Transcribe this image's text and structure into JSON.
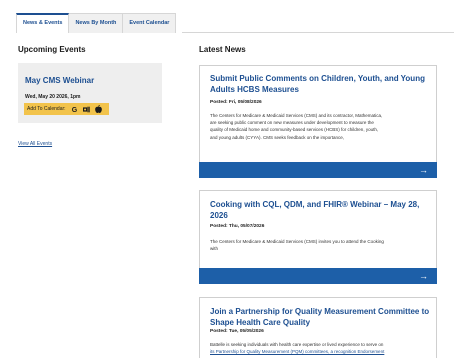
{
  "tabs": [
    "News & Events",
    "News By Month",
    "Event Calendar"
  ],
  "upcoming": {
    "heading": "Upcoming Events",
    "event": {
      "title": "May CMS Webinar",
      "date": "Wed, May 20 2026, 1pm",
      "add_label": "Add To Calendar:",
      "icons": [
        "google-icon",
        "outlook-icon",
        "apple-icon"
      ]
    },
    "view_all": "View All Events"
  },
  "news": {
    "heading": "Latest News",
    "items": [
      {
        "title_lines": [
          "Submit Public Comments on Children, Youth, and Young",
          "Adults HCBS Measures"
        ],
        "posted": "Posted:  Fri, 05/08/2026",
        "body_lines": [
          "The Centers for Medicare & Medicaid Services (CMS) and its contractor, Mathematica,",
          "are seeking public comment on new measures under development to measure the",
          "quality of Medicaid home and community-based services (HCBS) for children, youth,",
          "and young adults (CYYA). CMS seeks feedback on the importance,"
        ]
      },
      {
        "title_lines": [
          "Cooking with CQL, QDM, and FHIR® Webinar – May 28,",
          "2026"
        ],
        "posted": "Posted:  Thu, 05/07/2026",
        "body_lines": [
          "The Centers for Medicare & Medicaid Services (CMS) invites you to attend the Cooking",
          "with"
        ]
      },
      {
        "title_lines": [
          "Join a Partnership for Quality Measurement Committee to",
          "Shape Health Care Quality"
        ],
        "posted": "Posted:  Tue, 05/05/2026",
        "body_lines": [
          "Battelle is seeking individuals with health care expertise or lived experience to serve on",
          "its Partnership for Quality Measurement (PQM) committees, a recognition Endorsement"
        ]
      }
    ]
  },
  "colors": {
    "brand": "#1d4f91",
    "bar": "#1d5fa8",
    "calendar_button": "#f2c34b",
    "event_bg": "#eeeeee"
  }
}
